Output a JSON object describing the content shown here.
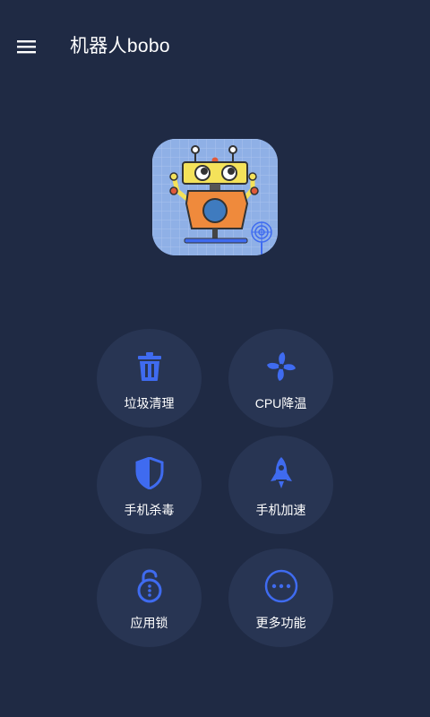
{
  "app": {
    "title": "机器人bobo"
  },
  "toolbar": {
    "menu_icon": "hamburger-menu-icon"
  },
  "logo": {
    "icon": "robot-logo"
  },
  "features": [
    {
      "label": "垃圾清理",
      "icon": "trash-icon"
    },
    {
      "label": "CPU降温",
      "icon": "fan-icon"
    },
    {
      "label": "手机杀毒",
      "icon": "shield-icon"
    },
    {
      "label": "手机加速",
      "icon": "rocket-icon"
    },
    {
      "label": "应用锁",
      "icon": "lock-icon"
    },
    {
      "label": "更多功能",
      "icon": "more-icon"
    }
  ],
  "colors": {
    "background": "#1f2a44",
    "button": "#283553",
    "accent": "#3f6bf0"
  }
}
